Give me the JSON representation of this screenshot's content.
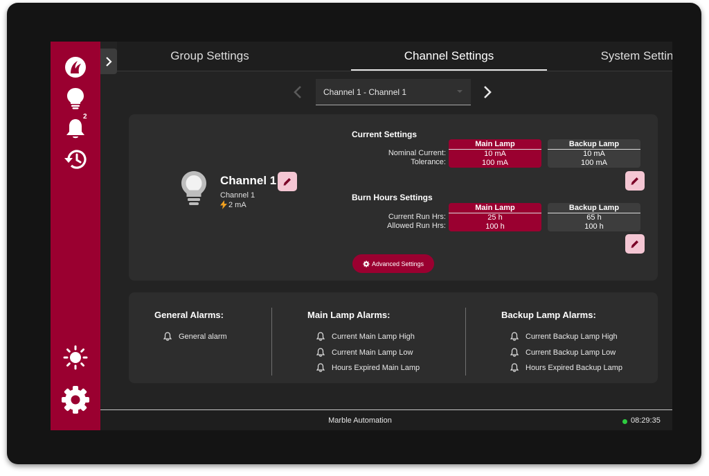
{
  "tabs": [
    {
      "label": "Group Settings"
    },
    {
      "label": "Channel Settings"
    },
    {
      "label": "System Settings"
    }
  ],
  "sidebar": {
    "items": [
      {
        "icon": "logo-icon"
      },
      {
        "icon": "lightbulb-icon"
      },
      {
        "icon": "bell-icon",
        "badge": "2"
      },
      {
        "icon": "history-icon"
      },
      {
        "icon": "brightness-icon"
      },
      {
        "icon": "settings-gear-icon"
      }
    ]
  },
  "channel_selector": {
    "value": "Channel 1 - Channel 1"
  },
  "channel": {
    "name": "Channel 1",
    "subtitle": "Channel 1",
    "current": "2 mA"
  },
  "current_settings": {
    "title": "Current Settings",
    "labels": [
      "Nominal Current:",
      "Tolerance:"
    ],
    "main": {
      "header": "Main Lamp",
      "values": [
        "10 mA",
        "100 mA"
      ]
    },
    "backup": {
      "header": "Backup Lamp",
      "values": [
        "10 mA",
        "100 mA"
      ]
    }
  },
  "burn_hours": {
    "title": "Burn Hours Settings",
    "labels": [
      "Current Run Hrs:",
      "Allowed Run Hrs:"
    ],
    "main": {
      "header": "Main Lamp",
      "values": [
        "25 h",
        "100 h"
      ]
    },
    "backup": {
      "header": "Backup Lamp",
      "values": [
        "65 h",
        "100 h"
      ]
    }
  },
  "advanced_button": "Advanced Settings",
  "alarms": {
    "general": {
      "title": "General Alarms:",
      "items": [
        "General alarm"
      ]
    },
    "main": {
      "title": "Main Lamp Alarms:",
      "items": [
        "Current Main Lamp High",
        "Current Main Lamp Low",
        "Hours Expired Main Lamp"
      ]
    },
    "backup": {
      "title": "Backup Lamp Alarms:",
      "items": [
        "Current Backup Lamp High",
        "Current Backup Lamp Low",
        "Hours Expired Backup Lamp"
      ]
    }
  },
  "footer": {
    "title": "Marble Automation",
    "time": "08:29:35"
  },
  "colors": {
    "accent": "#9a0030",
    "edit_button": "#f4c6d3",
    "status_ok": "#2ecc40",
    "background": "#232323"
  }
}
